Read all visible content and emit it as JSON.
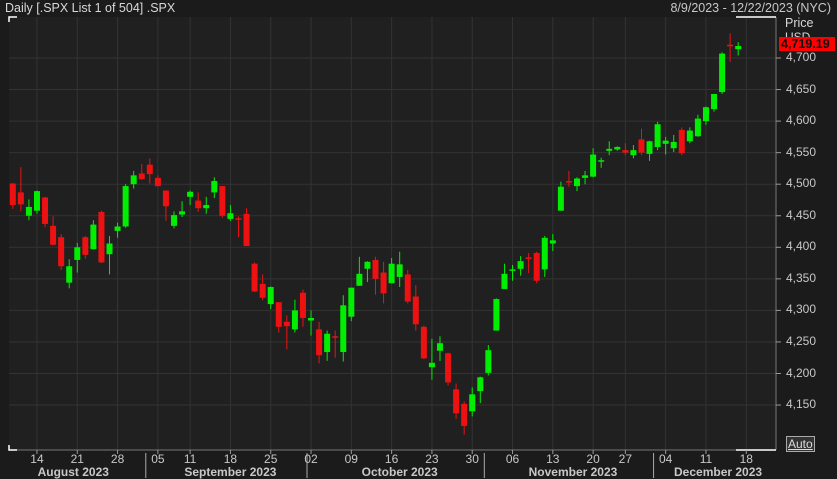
{
  "header": {
    "title": "Daily [.SPX List 1 of 504] .SPX",
    "range": "8/9/2023 - 12/22/2023 (NYC)"
  },
  "axis": {
    "price_label": "Price",
    "currency_label": "USD",
    "last_price": "4,719.19",
    "auto_label": "Auto"
  },
  "colors": {
    "up": "#00ee00",
    "down": "#ee1111",
    "background": "#202020",
    "grid": "#333333",
    "last_price_bg": "#ff0000"
  },
  "chart_data": {
    "type": "candlestick",
    "ylim": [
      4100,
      4740
    ],
    "yticks": [
      "4,150",
      "4,200",
      "4,250",
      "4,300",
      "4,350",
      "4,400",
      "4,450",
      "4,500",
      "4,550",
      "4,600",
      "4,650",
      "4,700"
    ],
    "ytick_values": [
      4150,
      4200,
      4250,
      4300,
      4350,
      4400,
      4450,
      4500,
      4550,
      4600,
      4650,
      4700
    ],
    "xticks": [
      {
        "label": "14",
        "i": 3
      },
      {
        "label": "21",
        "i": 8
      },
      {
        "label": "28",
        "i": 13
      },
      {
        "label": "05",
        "i": 18
      },
      {
        "label": "11",
        "i": 22
      },
      {
        "label": "18",
        "i": 27
      },
      {
        "label": "25",
        "i": 32
      },
      {
        "label": "02",
        "i": 37
      },
      {
        "label": "09",
        "i": 42
      },
      {
        "label": "16",
        "i": 47
      },
      {
        "label": "23",
        "i": 52
      },
      {
        "label": "30",
        "i": 57
      },
      {
        "label": "06",
        "i": 62
      },
      {
        "label": "13",
        "i": 67
      },
      {
        "label": "20",
        "i": 72
      },
      {
        "label": "27",
        "i": 76
      },
      {
        "label": "04",
        "i": 81
      },
      {
        "label": "11",
        "i": 86
      },
      {
        "label": "18",
        "i": 91
      }
    ],
    "months": [
      {
        "label": "August 2023",
        "i": 7.5
      },
      {
        "label": "September 2023",
        "i": 27
      },
      {
        "label": "October 2023",
        "i": 48
      },
      {
        "label": "November 2023",
        "i": 69.5
      },
      {
        "label": "December 2023",
        "i": 87.5
      }
    ],
    "month_breaks": [
      16.5,
      36.5,
      58.5,
      79.5
    ],
    "grid": true,
    "candles": [
      [
        "8/9",
        4501,
        4502,
        4461,
        4467
      ],
      [
        "8/10",
        4487,
        4527,
        4457,
        4468
      ],
      [
        "8/11",
        4450,
        4476,
        4443,
        4464
      ],
      [
        "8/14",
        4458,
        4490,
        4453,
        4489
      ],
      [
        "8/15",
        4479,
        4480,
        4432,
        4437
      ],
      [
        "8/16",
        4434,
        4449,
        4403,
        4404
      ],
      [
        "8/17",
        4416,
        4421,
        4364,
        4370
      ],
      [
        "8/18",
        4344,
        4381,
        4335,
        4370
      ],
      [
        "8/21",
        4380,
        4407,
        4360,
        4400
      ],
      [
        "8/22",
        4416,
        4418,
        4382,
        4388
      ],
      [
        "8/23",
        4397,
        4443,
        4397,
        4436
      ],
      [
        "8/24",
        4456,
        4458,
        4375,
        4376
      ],
      [
        "8/25",
        4389,
        4418,
        4357,
        4406
      ],
      [
        "8/28",
        4426,
        4439,
        4415,
        4433
      ],
      [
        "8/29",
        4433,
        4500,
        4431,
        4497
      ],
      [
        "8/30",
        4500,
        4521,
        4493,
        4514
      ],
      [
        "8/31",
        4517,
        4532,
        4507,
        4508
      ],
      [
        "9/1",
        4531,
        4541,
        4501,
        4516
      ],
      [
        "9/5",
        4510,
        4514,
        4496,
        4497
      ],
      [
        "9/6",
        4490,
        4490,
        4442,
        4465
      ],
      [
        "9/7",
        4434,
        4457,
        4430,
        4451
      ],
      [
        "9/8",
        4452,
        4473,
        4448,
        4457
      ],
      [
        "9/11",
        4480,
        4490,
        4467,
        4488
      ],
      [
        "9/12",
        4474,
        4487,
        4456,
        4462
      ],
      [
        "9/13",
        4462,
        4480,
        4453,
        4467
      ],
      [
        "9/14",
        4487,
        4511,
        4478,
        4505
      ],
      [
        "9/15",
        4497,
        4497,
        4447,
        4450
      ],
      [
        "9/18",
        4445,
        4467,
        4442,
        4454
      ],
      [
        "9/19",
        4446,
        4449,
        4416,
        4444
      ],
      [
        "9/20",
        4453,
        4462,
        4402,
        4402
      ],
      [
        "9/21",
        4374,
        4376,
        4329,
        4330
      ],
      [
        "9/22",
        4342,
        4357,
        4316,
        4320
      ],
      [
        "9/25",
        4310,
        4338,
        4302,
        4337
      ],
      [
        "9/26",
        4313,
        4313,
        4265,
        4274
      ],
      [
        "9/27",
        4282,
        4292,
        4238,
        4275
      ],
      [
        "9/28",
        4270,
        4317,
        4265,
        4300
      ],
      [
        "9/29",
        4328,
        4333,
        4274,
        4288
      ],
      [
        "10/2",
        4284,
        4300,
        4260,
        4288
      ],
      [
        "10/3",
        4270,
        4282,
        4216,
        4229
      ],
      [
        "10/4",
        4234,
        4268,
        4220,
        4263
      ],
      [
        "10/5",
        4259,
        4268,
        4225,
        4258
      ],
      [
        "10/6",
        4234,
        4324,
        4219,
        4308
      ],
      [
        "10/9",
        4290,
        4336,
        4283,
        4336
      ],
      [
        "10/10",
        4339,
        4385,
        4339,
        4358
      ],
      [
        "10/11",
        4366,
        4378,
        4345,
        4377
      ],
      [
        "10/12",
        4380,
        4385,
        4325,
        4350
      ],
      [
        "10/13",
        4360,
        4377,
        4311,
        4327
      ],
      [
        "10/16",
        4343,
        4383,
        4343,
        4374
      ],
      [
        "10/17",
        4353,
        4393,
        4337,
        4373
      ],
      [
        "10/18",
        4357,
        4364,
        4311,
        4314
      ],
      [
        "10/19",
        4322,
        4340,
        4268,
        4278
      ],
      [
        "10/20",
        4274,
        4276,
        4223,
        4224
      ],
      [
        "10/23",
        4210,
        4255,
        4190,
        4217
      ],
      [
        "10/24",
        4236,
        4259,
        4220,
        4248
      ],
      [
        "10/25",
        4232,
        4233,
        4181,
        4186
      ],
      [
        "10/26",
        4175,
        4184,
        4128,
        4137
      ],
      [
        "10/27",
        4152,
        4156,
        4103,
        4117
      ],
      [
        "10/30",
        4140,
        4178,
        4132,
        4167
      ],
      [
        "10/31",
        4172,
        4195,
        4153,
        4194
      ],
      [
        "11/1",
        4201,
        4245,
        4197,
        4237
      ],
      [
        "11/2",
        4268,
        4319,
        4268,
        4318
      ],
      [
        "11/3",
        4334,
        4374,
        4334,
        4358
      ],
      [
        "11/6",
        4365,
        4372,
        4347,
        4365
      ],
      [
        "11/7",
        4366,
        4386,
        4355,
        4378
      ],
      [
        "11/8",
        4384,
        4391,
        4359,
        4383
      ],
      [
        "11/9",
        4391,
        4393,
        4343,
        4347
      ],
      [
        "11/10",
        4365,
        4418,
        4353,
        4415
      ],
      [
        "11/13",
        4406,
        4421,
        4394,
        4411
      ],
      [
        "11/14",
        4458,
        4504,
        4458,
        4496
      ],
      [
        "11/15",
        4505,
        4521,
        4496,
        4503
      ],
      [
        "11/16",
        4497,
        4511,
        4489,
        4509
      ],
      [
        "11/17",
        4510,
        4521,
        4500,
        4514
      ],
      [
        "11/20",
        4512,
        4557,
        4511,
        4547
      ],
      [
        "11/21",
        4538,
        4542,
        4526,
        4538
      ],
      [
        "11/22",
        4553,
        4568,
        4546,
        4556
      ],
      [
        "11/24",
        4555,
        4560,
        4553,
        4559
      ],
      [
        "11/27",
        4554,
        4565,
        4546,
        4550
      ],
      [
        "11/28",
        4546,
        4562,
        4541,
        4554
      ],
      [
        "11/29",
        4571,
        4588,
        4546,
        4550
      ],
      [
        "11/30",
        4548,
        4569,
        4537,
        4568
      ],
      [
        "12/1",
        4559,
        4599,
        4554,
        4595
      ],
      [
        "12/4",
        4564,
        4575,
        4547,
        4569
      ],
      [
        "12/5",
        4557,
        4578,
        4551,
        4567
      ],
      [
        "12/6",
        4586,
        4590,
        4546,
        4549
      ],
      [
        "12/7",
        4568,
        4590,
        4565,
        4585
      ],
      [
        "12/8",
        4576,
        4610,
        4575,
        4604
      ],
      [
        "12/11",
        4600,
        4623,
        4594,
        4622
      ],
      [
        "12/12",
        4619,
        4643,
        4615,
        4643
      ],
      [
        "12/13",
        4646,
        4709,
        4643,
        4707
      ],
      [
        "12/14",
        4721,
        4739,
        4694,
        4719
      ],
      [
        "12/15",
        4714,
        4725,
        4704,
        4719
      ]
    ]
  }
}
